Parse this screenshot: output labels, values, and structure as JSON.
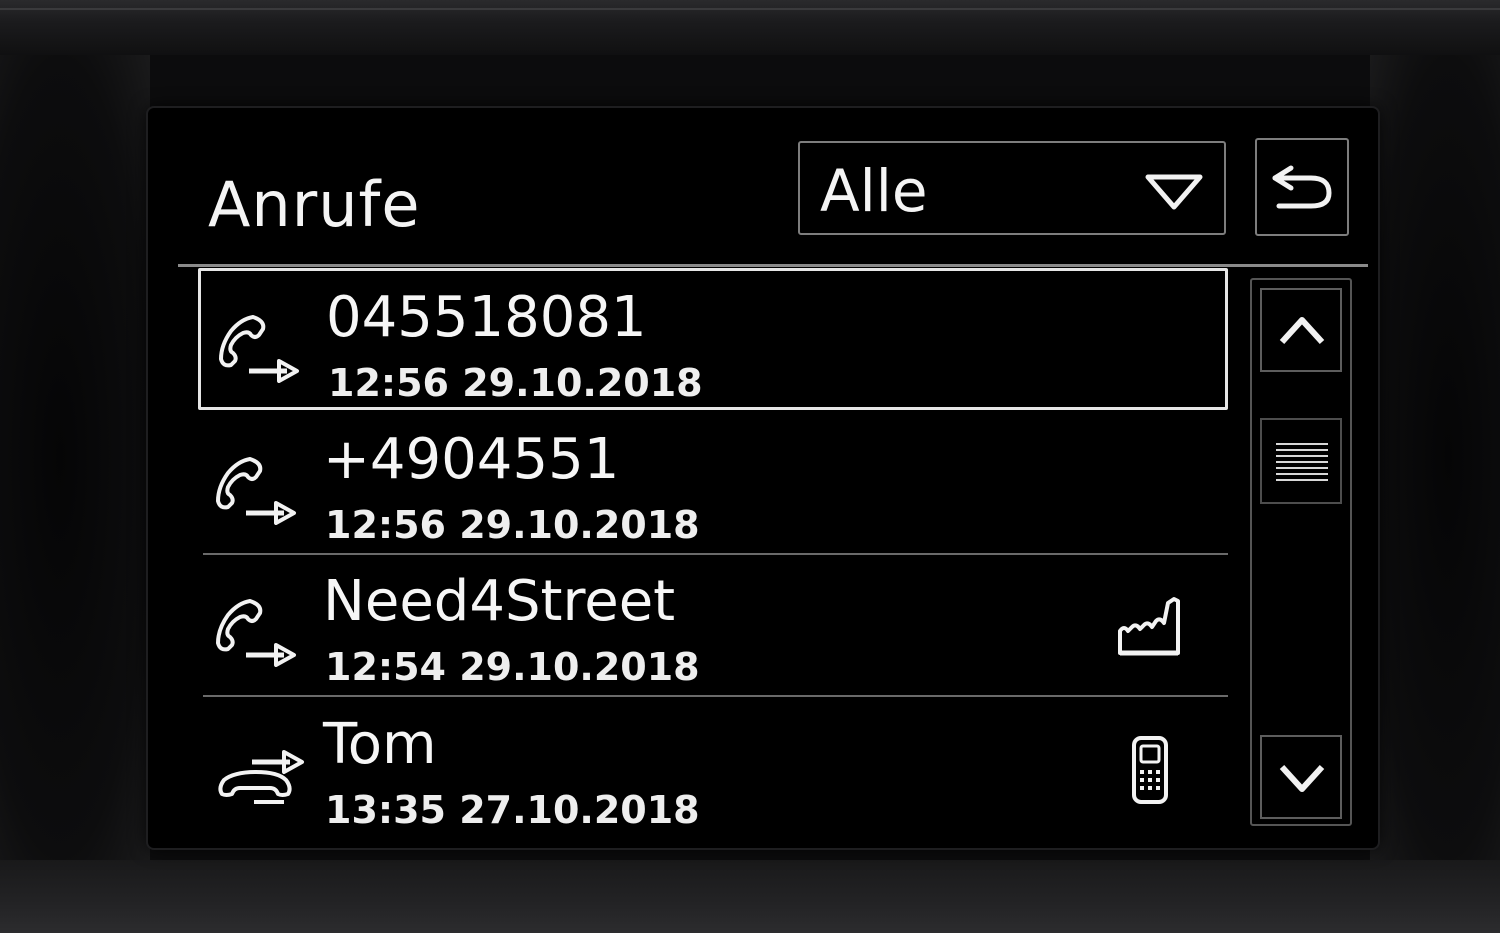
{
  "header": {
    "title": "Anrufe",
    "filter_value": "Alle"
  },
  "calls": [
    {
      "name": "045518081",
      "time": "12:56 29.10.2018",
      "direction": "outgoing",
      "number_type": "",
      "selected": true
    },
    {
      "name": "+4904551",
      "time": "12:56 29.10.2018",
      "direction": "outgoing",
      "number_type": "",
      "selected": false
    },
    {
      "name": "Need4Street",
      "time": "12:54 29.10.2018",
      "direction": "outgoing",
      "number_type": "business-icon",
      "selected": false
    },
    {
      "name": "Tom",
      "time": "13:35 27.10.2018",
      "direction": "incoming",
      "number_type": "mobile-phone-icon",
      "selected": false
    }
  ],
  "colors": {
    "screen_background": "#000000",
    "text": "#f2f2f2",
    "border": "#7d7d7d"
  }
}
